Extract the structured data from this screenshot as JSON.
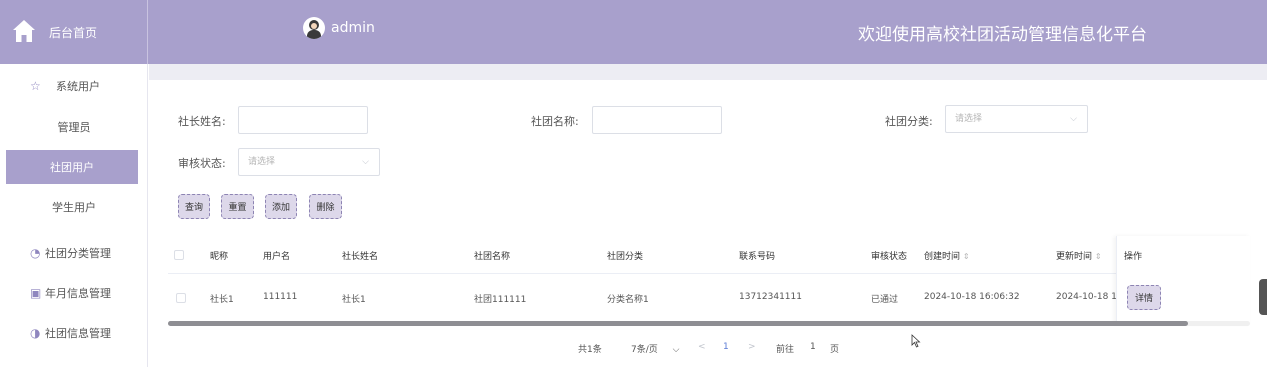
{
  "header": {
    "home_label": "后台首页",
    "admin_name": "admin",
    "site_title": "欢迎使用高校社团活动管理信息化平台",
    "accent_color": "#a8a0cc"
  },
  "sidebar": {
    "system_users": {
      "label": "系统用户",
      "icon": "star-outline-icon"
    },
    "items": [
      {
        "label": "管理员"
      },
      {
        "label": "社团用户",
        "active": true
      },
      {
        "label": "学生用户"
      }
    ],
    "groups": [
      {
        "label": "社团分类管理",
        "icon": "clock-icon"
      },
      {
        "label": "年月信息管理",
        "icon": "calendar-icon"
      },
      {
        "label": "社团信息管理",
        "icon": "pie-icon"
      }
    ]
  },
  "search": {
    "leader_name_label": "社长姓名:",
    "leader_name_value": "",
    "club_name_label": "社团名称:",
    "club_name_value": "",
    "club_category_label": "社团分类:",
    "club_category_placeholder": "请选择",
    "review_status_label": "审核状态:",
    "review_status_placeholder": "请选择"
  },
  "actions": {
    "query": "查询",
    "reset": "重置",
    "add": "添加",
    "delete": "删除"
  },
  "table": {
    "headers": [
      "昵称",
      "用户名",
      "社长姓名",
      "社团名称",
      "社团分类",
      "联系号码",
      "审核状态",
      "创建时间",
      "更新时间",
      "操作"
    ],
    "rows": [
      {
        "nickname": "社长1",
        "username": "111111",
        "leader_name": "社长1",
        "club_name": "社团111111",
        "category": "分类名称1",
        "phone": "13712341111",
        "status": "已通过",
        "created": "2024-10-18 16:06:32",
        "updated": "2024-10-18 1",
        "detail": "详情"
      }
    ],
    "sort_icon": "⇕"
  },
  "pagination": {
    "total": "共1条",
    "page_size": "7条/页",
    "prev": "<",
    "current_page": "1",
    "next": ">",
    "goto_label": "前往",
    "goto_value": "1",
    "page_unit": "页"
  }
}
